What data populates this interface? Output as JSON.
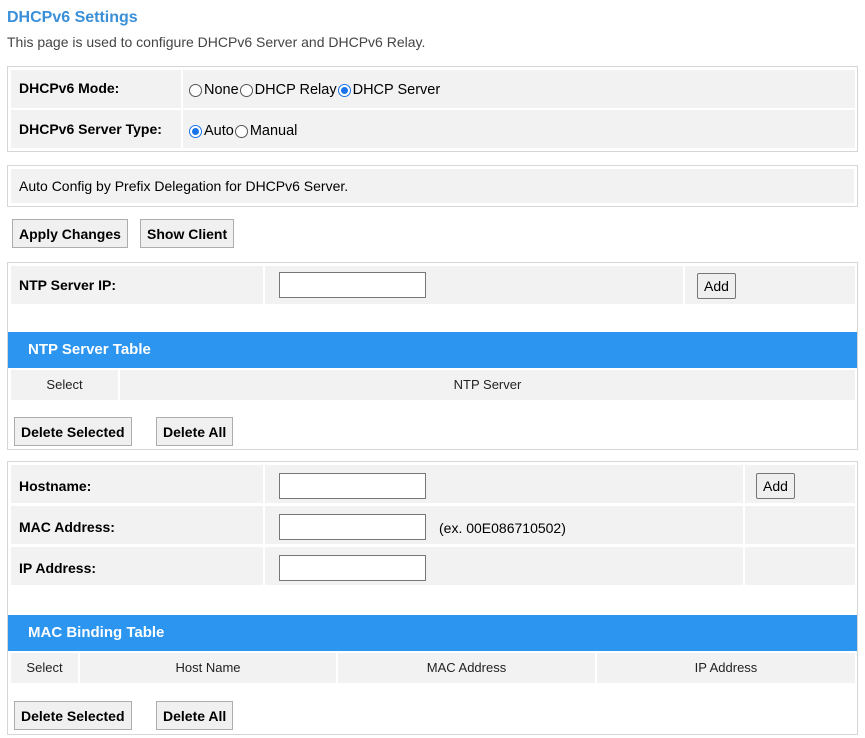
{
  "page": {
    "title": "DHCPv6 Settings",
    "description": "This page is used to configure DHCPv6 Server and DHCPv6 Relay."
  },
  "mode": {
    "label": "DHCPv6 Mode:",
    "options": [
      "None",
      "DHCP Relay",
      "DHCP Server"
    ],
    "selected": "DHCP Server"
  },
  "server_type": {
    "label": "DHCPv6 Server Type:",
    "options": [
      "Auto",
      "Manual"
    ],
    "selected": "Auto"
  },
  "auto_config": {
    "text": "Auto Config by Prefix Delegation for DHCPv6 Server."
  },
  "actions": {
    "apply_label": "Apply Changes",
    "show_client_label": "Show Client"
  },
  "ntp": {
    "ip_label": "NTP Server IP:",
    "ip_value": "",
    "add_label": "Add",
    "table_title": "NTP Server Table",
    "columns": [
      "Select",
      "NTP Server"
    ],
    "delete_selected_label": "Delete Selected",
    "delete_all_label": "Delete All"
  },
  "mac_binding": {
    "hostname_label": "Hostname:",
    "hostname_value": "",
    "mac_label": "MAC Address:",
    "mac_value": "",
    "mac_hint": "(ex. 00E086710502)",
    "ip_label": "IP Address:",
    "ip_value": "",
    "add_label": "Add",
    "table_title": "MAC Binding Table",
    "columns": [
      "Select",
      "Host Name",
      "MAC Address",
      "IP Address"
    ],
    "delete_selected_label": "Delete Selected",
    "delete_all_label": "Delete All"
  },
  "colors": {
    "title": "#3a8fd9",
    "table_header": "#2b95f0",
    "radio_checked": "#1a73e8",
    "cell_bg": "#f2f2f2"
  }
}
